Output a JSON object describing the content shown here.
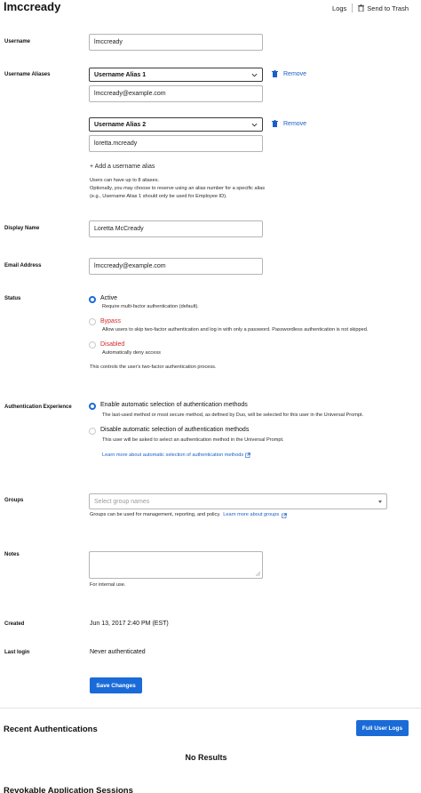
{
  "header": {
    "title": "lmccready",
    "logs_label": "Logs",
    "trash_label": "Send to Trash"
  },
  "username": {
    "label": "Username",
    "value": "lmccready"
  },
  "aliases": {
    "label": "Username Aliases",
    "items": [
      {
        "select": "Username Alias 1",
        "value": "lmccready@example.com",
        "remove": "Remove"
      },
      {
        "select": "Username Alias 2",
        "value": "loretta.mcready",
        "remove": "Remove"
      }
    ],
    "add_label": "+ Add a username alias",
    "help_1": "Users can have up to 8 aliases.",
    "help_2": "Optionally, you may choose to reserve using an alias number for a specific alias",
    "help_3": "(e.g., Username Alias 1 should only be used for Employee ID)."
  },
  "display_name": {
    "label": "Display Name",
    "value": "Loretta McCready"
  },
  "email": {
    "label": "Email Address",
    "value": "lmccready@example.com"
  },
  "status": {
    "label": "Status",
    "options": [
      {
        "title": "Active",
        "desc": "Require multi-factor authentication (default).",
        "selected": true
      },
      {
        "title": "Bypass",
        "desc": "Allow users to skip two-factor authentication and log in with only a password. Passwordless authentication is not skipped.",
        "selected": false
      },
      {
        "title": "Disabled",
        "desc": "Automatically deny access",
        "selected": false
      }
    ],
    "footer": "This controls the user's two-factor authentication process."
  },
  "auth_experience": {
    "label": "Authentication Experience",
    "options": [
      {
        "title": "Enable automatic selection of authentication methods",
        "desc": "The last-used method or most secure method, as defined by Duo, will be selected for this user in the Universal Prompt.",
        "selected": true
      },
      {
        "title": "Disable automatic selection of authentication methods",
        "desc": "This user will be asked to select an authentication method in the Universal Prompt.",
        "selected": false
      }
    ],
    "learn_more": "Learn more about automatic selection of authentication methods"
  },
  "groups": {
    "label": "Groups",
    "placeholder": "Select group names",
    "help": "Groups can be used for management, reporting, and policy.",
    "learn_more": "Learn more about groups"
  },
  "notes": {
    "label": "Notes",
    "help": "For internal use."
  },
  "created": {
    "label": "Created",
    "value": "Jun 13, 2017 2:40 PM (EST)"
  },
  "last_login": {
    "label": "Last login",
    "value": "Never authenticated"
  },
  "save_label": "Save Changes",
  "recent_auth": {
    "title": "Recent Authentications",
    "button": "Full User Logs",
    "empty": "No Results"
  },
  "next_section": "Revokable Application Sessions",
  "colors": {
    "primary": "#1a6bd8",
    "link": "#1a5fc8",
    "danger": "#d12b2b"
  }
}
